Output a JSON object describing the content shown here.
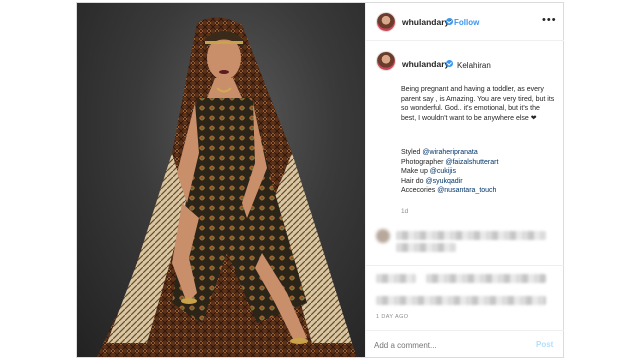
{
  "post": {
    "username": "whulandary",
    "follow_label": "Follow",
    "more_label": "•••",
    "location": "Kelahiran",
    "caption": "Being pregnant and having a toddler, as every parent say , is Amazing. You are very tired, but its so wonderful. God.. it's emotional, but it's the best, I wouldn't want to be anywhere else ❤",
    "credits": [
      {
        "prefix": "Styled ",
        "mention": "@wiraheripranata"
      },
      {
        "prefix": "Photographer ",
        "mention": "@faizalshutterart"
      },
      {
        "prefix": "Make up ",
        "mention": "@cukijis"
      },
      {
        "prefix": "Hair do ",
        "mention": "@syukqadir"
      },
      {
        "prefix": "Accecories ",
        "mention": "@nusantara_touch"
      }
    ],
    "caption_age": "1d",
    "date": "1 DAY AGO",
    "comment_placeholder": "Add a comment...",
    "post_button": "Post"
  },
  "colors": {
    "accent": "#3897f0",
    "border": "#dbdbdb",
    "muted": "#8e8e8e",
    "text": "#262626"
  },
  "icons": {
    "verified": "verified-badge-icon",
    "more": "more-options-icon"
  }
}
